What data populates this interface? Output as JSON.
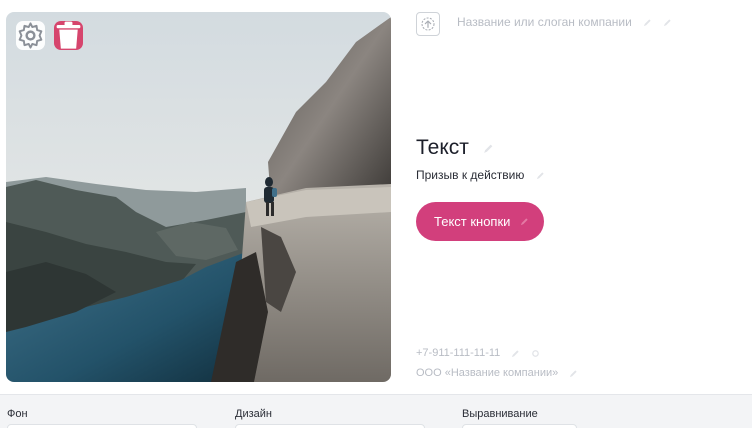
{
  "photo": {
    "settings_icon": "gear-icon",
    "delete_icon": "trash-icon",
    "delete_color": "#d6456d"
  },
  "header": {
    "logo_icon": "upload-icon",
    "slogan_placeholder": "Название или слоган компании"
  },
  "content": {
    "title": "Текст",
    "subtitle": "Призыв к действию",
    "button_label": "Текст кнопки",
    "button_color": "#d23f7c",
    "edit_icon": "pencil-icon"
  },
  "footer": {
    "phone": "+7-911-111-11-11",
    "company": "ООО «Название компании»"
  },
  "settings_bar": {
    "labels": [
      "Фон",
      "Дизайн",
      "Выравнивание"
    ]
  }
}
